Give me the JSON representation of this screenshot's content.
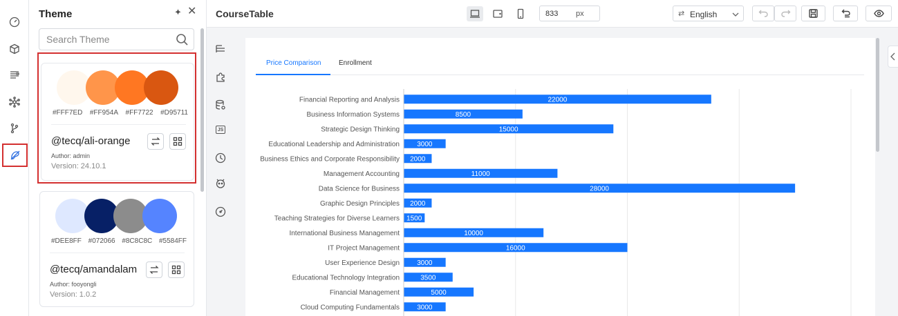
{
  "theme_panel": {
    "title": "Theme",
    "search_placeholder": "Search Theme",
    "themes": [
      {
        "name": "@tecq/ali-orange",
        "author": "Author: admin",
        "version": "Version: 24.10.1",
        "colors": [
          "#FFF7ED",
          "#FF954A",
          "#FF7722",
          "#D95711"
        ],
        "selected": true
      },
      {
        "name": "@tecq/amandalam",
        "author": "Author: fooyongli",
        "version": "Version: 1.0.2",
        "colors": [
          "#DEE8FF",
          "#072066",
          "#8C8C8C",
          "#5584FF"
        ],
        "selected": false
      }
    ]
  },
  "topbar": {
    "title": "CourseTable",
    "width_value": "833",
    "width_unit": "px",
    "language": "English"
  },
  "tabs": [
    "Price Comparison",
    "Enrollment"
  ],
  "chart_data": {
    "type": "bar",
    "orientation": "horizontal",
    "categories": [
      "Financial Reporting and Analysis",
      "Business Information Systems",
      "Strategic Design Thinking",
      "Educational Leadership and Administration",
      "Business Ethics and Corporate Responsibility",
      "Management Accounting",
      "Data Science for Business",
      "Graphic Design Principles",
      "Teaching Strategies for Diverse Learners",
      "International Business Management",
      "IT Project Management",
      "User Experience Design",
      "Educational Technology Integration",
      "Financial Management",
      "Cloud Computing Fundamentals"
    ],
    "values": [
      22000,
      8500,
      15000,
      3000,
      2000,
      11000,
      28000,
      2000,
      1500,
      10000,
      16000,
      3000,
      3500,
      5000,
      3000
    ],
    "xlim": [
      0,
      32000
    ],
    "grid": true,
    "color": "#1677ff"
  }
}
